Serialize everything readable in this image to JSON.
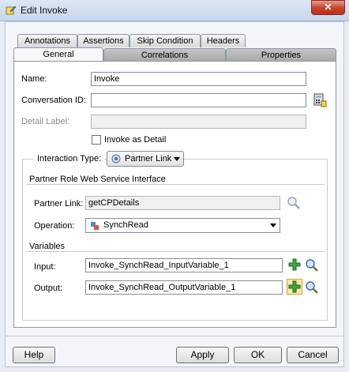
{
  "window": {
    "title": "Edit Invoke"
  },
  "tabs": {
    "row1": [
      "Annotations",
      "Assertions",
      "Skip Condition",
      "Headers"
    ],
    "row2": [
      "General",
      "Correlations",
      "Properties"
    ]
  },
  "form": {
    "name_label": "Name:",
    "name_value": "Invoke",
    "conversation_label": "Conversation ID:",
    "conversation_value": "",
    "detail_label": "Detail Label:",
    "detail_value": "",
    "invoke_as_detail": "Invoke as Detail",
    "invoke_as_detail_checked": false
  },
  "interaction": {
    "label": "Interaction Type:",
    "type_value": "Partner Link",
    "section_title": "Partner Role Web Service Interface",
    "partner_link_label": "Partner Link:",
    "partner_link_value": "getCPDetails",
    "operation_label": "Operation:",
    "operation_value": "SynchRead",
    "variables_title": "Variables",
    "input_label": "Input:",
    "input_value": "Invoke_SynchRead_InputVariable_1",
    "output_label": "Output:",
    "output_value": "Invoke_SynchRead_OutputVariable_1"
  },
  "buttons": {
    "help": "Help",
    "apply": "Apply",
    "ok": "OK",
    "cancel": "Cancel"
  },
  "icons": {
    "app": "edit-invoke-icon",
    "conversation_helper": "calculator-icon",
    "partner_link_search": "magnifier-icon",
    "operation": "operation-icon",
    "add": "add-plus-icon",
    "search": "magnifier-icon"
  }
}
